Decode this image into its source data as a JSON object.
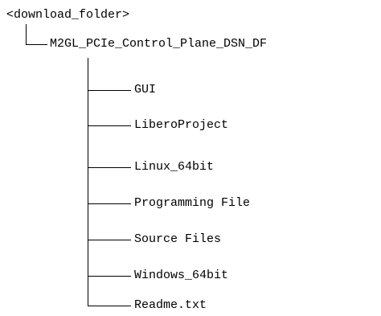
{
  "tree": {
    "root": "<download_folder>",
    "folder": "M2GL_PCIe_Control_Plane_DSN_DF",
    "children": [
      "GUI",
      "LiberoProject",
      "Linux_64bit",
      "Programming File",
      "Source Files",
      "Windows_64bit",
      "Readme.txt"
    ]
  },
  "colors": {
    "line": "#000000",
    "text": "#000000",
    "background": "#ffffff"
  }
}
